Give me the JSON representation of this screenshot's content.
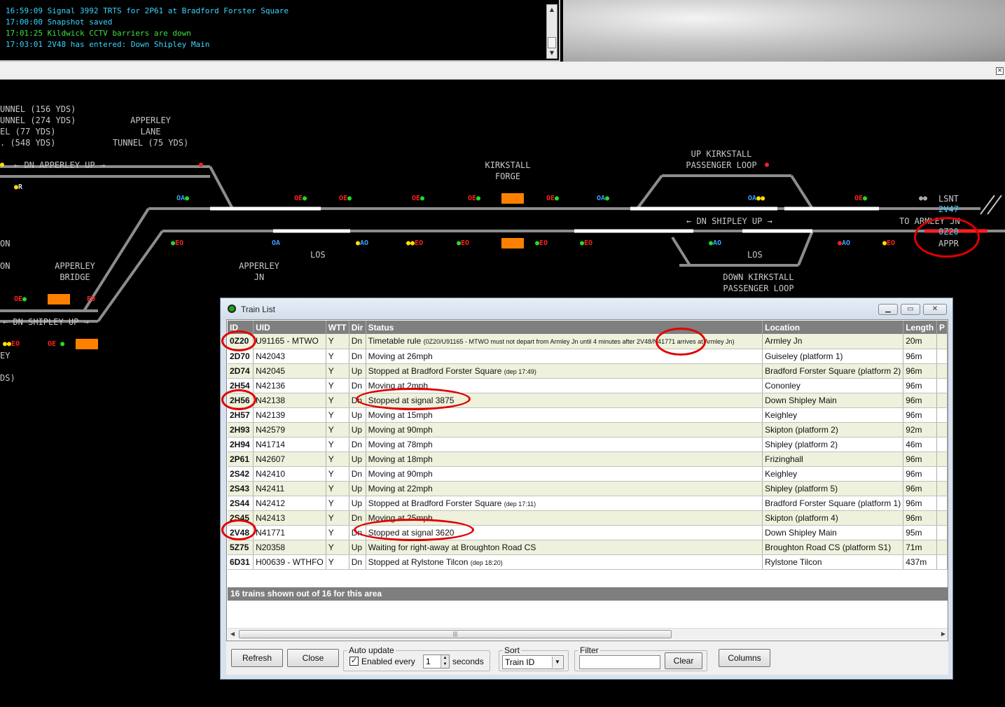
{
  "message_log": {
    "lines": [
      {
        "text": "16:59:09 Signal 3992 TRTS for 2P61 at Bradford Forster Square",
        "color": "#37d6ff"
      },
      {
        "text": "17:00:00 Snapshot saved",
        "color": "#37d6ff"
      },
      {
        "text": "17:01:25 Kildwick CCTV barriers are down",
        "color": "#3ee03e"
      },
      {
        "text": "17:03:01 2V48 has entered: Down Shipley Main",
        "color": "#37d6ff"
      }
    ]
  },
  "diagram": {
    "labels": {
      "tunnel1": "UNNEL (156 YDS)",
      "tunnel2": "UNNEL (274 YDS)",
      "tunnel3": "EL (77 YDS)",
      "tunnel4": ". (548 YDS)",
      "apperley_lane": "APPERLEY\nLANE\nTUNNEL (75 YDS)",
      "dn_apperley_up": "← DN APPERLEY UP →",
      "kirkstall_forge": "KIRKSTALL\nFORGE",
      "up_kirkstall_loop": "UP KIRKSTALL\nPASSENGER LOOP",
      "dn_shipley_up_right": "← DN SHIPLEY UP →",
      "down_kirkstall_loop": "DOWN KIRKSTALL\nPASSENGER LOOP",
      "los1": "LOS",
      "los2": "LOS",
      "apperley_jn": "APPERLEY\nJN",
      "apperley_bridge": "APPERLEY\nBRIDGE",
      "dn_shipley_up_left": "← DN SHIPLEY UP →",
      "on1": "ON",
      "on2": "ON",
      "ey": "EY",
      "ds": "DS)",
      "lsnt": "LSNT",
      "to_armley": "TO ARMLEY JN",
      "appr": "APPR"
    },
    "berths": {
      "td1": "2V47",
      "td2": "0Z20"
    }
  },
  "train_list": {
    "title": "Train List",
    "columns": [
      "ID",
      "UID",
      "WTT",
      "Dir",
      "Status",
      "Location",
      "Length",
      "P"
    ],
    "rows": [
      {
        "id": "0Z20",
        "uid": "U91165 - MTWO",
        "wtt": "Y",
        "dir": "Dn",
        "status": "Timetable rule",
        "status_small": "(0Z20/U91165 - MTWO must not depart from Armley Jn until 4 minutes after 2V48/N41771 arrives at Armley Jn)",
        "location": "Armley Jn",
        "length": "20m"
      },
      {
        "id": "2D70",
        "uid": "N42043",
        "wtt": "Y",
        "dir": "Dn",
        "status": "Moving at 26mph",
        "status_small": "",
        "location": "Guiseley (platform 1)",
        "length": "96m"
      },
      {
        "id": "2D74",
        "uid": "N42045",
        "wtt": "Y",
        "dir": "Up",
        "status": "Stopped at Bradford Forster Square",
        "status_small": "(dep 17:49)",
        "location": "Bradford Forster Square (platform 2)",
        "length": "96m"
      },
      {
        "id": "2H54",
        "uid": "N42136",
        "wtt": "Y",
        "dir": "Dn",
        "status": "Moving at 2mph",
        "status_small": "",
        "location": "Cononley",
        "length": "96m"
      },
      {
        "id": "2H56",
        "uid": "N42138",
        "wtt": "Y",
        "dir": "Dn",
        "status": "Stopped at signal 3875",
        "status_small": "",
        "location": "Down Shipley Main",
        "length": "96m"
      },
      {
        "id": "2H57",
        "uid": "N42139",
        "wtt": "Y",
        "dir": "Up",
        "status": "Moving at 15mph",
        "status_small": "",
        "location": "Keighley",
        "length": "96m"
      },
      {
        "id": "2H93",
        "uid": "N42579",
        "wtt": "Y",
        "dir": "Up",
        "status": "Moving at 90mph",
        "status_small": "",
        "location": "Skipton (platform 2)",
        "length": "92m"
      },
      {
        "id": "2H94",
        "uid": "N41714",
        "wtt": "Y",
        "dir": "Dn",
        "status": "Moving at 78mph",
        "status_small": "",
        "location": "Shipley (platform 2)",
        "length": "46m"
      },
      {
        "id": "2P61",
        "uid": "N42607",
        "wtt": "Y",
        "dir": "Up",
        "status": "Moving at 18mph",
        "status_small": "",
        "location": "Frizinghall",
        "length": "96m"
      },
      {
        "id": "2S42",
        "uid": "N42410",
        "wtt": "Y",
        "dir": "Dn",
        "status": "Moving at 90mph",
        "status_small": "",
        "location": "Keighley",
        "length": "96m"
      },
      {
        "id": "2S43",
        "uid": "N42411",
        "wtt": "Y",
        "dir": "Up",
        "status": "Moving at 22mph",
        "status_small": "",
        "location": "Shipley (platform 5)",
        "length": "96m"
      },
      {
        "id": "2S44",
        "uid": "N42412",
        "wtt": "Y",
        "dir": "Up",
        "status": "Stopped at Bradford Forster Square",
        "status_small": "(dep 17:11)",
        "location": "Bradford Forster Square (platform 1)",
        "length": "96m"
      },
      {
        "id": "2S45",
        "uid": "N42413",
        "wtt": "Y",
        "dir": "Dn",
        "status": "Moving at 25mph",
        "status_small": "",
        "location": "Skipton (platform 4)",
        "length": "96m"
      },
      {
        "id": "2V48",
        "uid": "N41771",
        "wtt": "Y",
        "dir": "Dn",
        "status": "Stopped at signal 3620",
        "status_small": "",
        "location": "Down Shipley Main",
        "length": "95m"
      },
      {
        "id": "5Z75",
        "uid": "N20358",
        "wtt": "Y",
        "dir": "Up",
        "status": "Waiting for right-away at Broughton Road CS",
        "status_small": "",
        "location": "Broughton Road CS (platform S1)",
        "length": "71m"
      },
      {
        "id": "6D31",
        "uid": "H00639 - WTHFO",
        "wtt": "Y",
        "dir": "Dn",
        "status": "Stopped at Rylstone Tilcon",
        "status_small": "(dep 18:20)",
        "location": "Rylstone Tilcon",
        "length": "437m"
      }
    ],
    "summary": "16 trains shown out of 16 for this area",
    "controls": {
      "refresh": "Refresh",
      "close": "Close",
      "auto_update_legend": "Auto update",
      "enabled_label": "Enabled every",
      "enabled_checked": true,
      "interval": "1",
      "seconds": "seconds",
      "sort_legend": "Sort",
      "sort_value": "Train ID",
      "filter_legend": "Filter",
      "filter_value": "",
      "clear": "Clear",
      "columns": "Columns"
    }
  },
  "colors": {
    "annotation": "#e00000",
    "row_alt": "#eef2dc",
    "header": "#7f7f7f",
    "berth": "#ff8000",
    "signal_red": "#ff2020",
    "signal_green": "#1fe01f"
  }
}
